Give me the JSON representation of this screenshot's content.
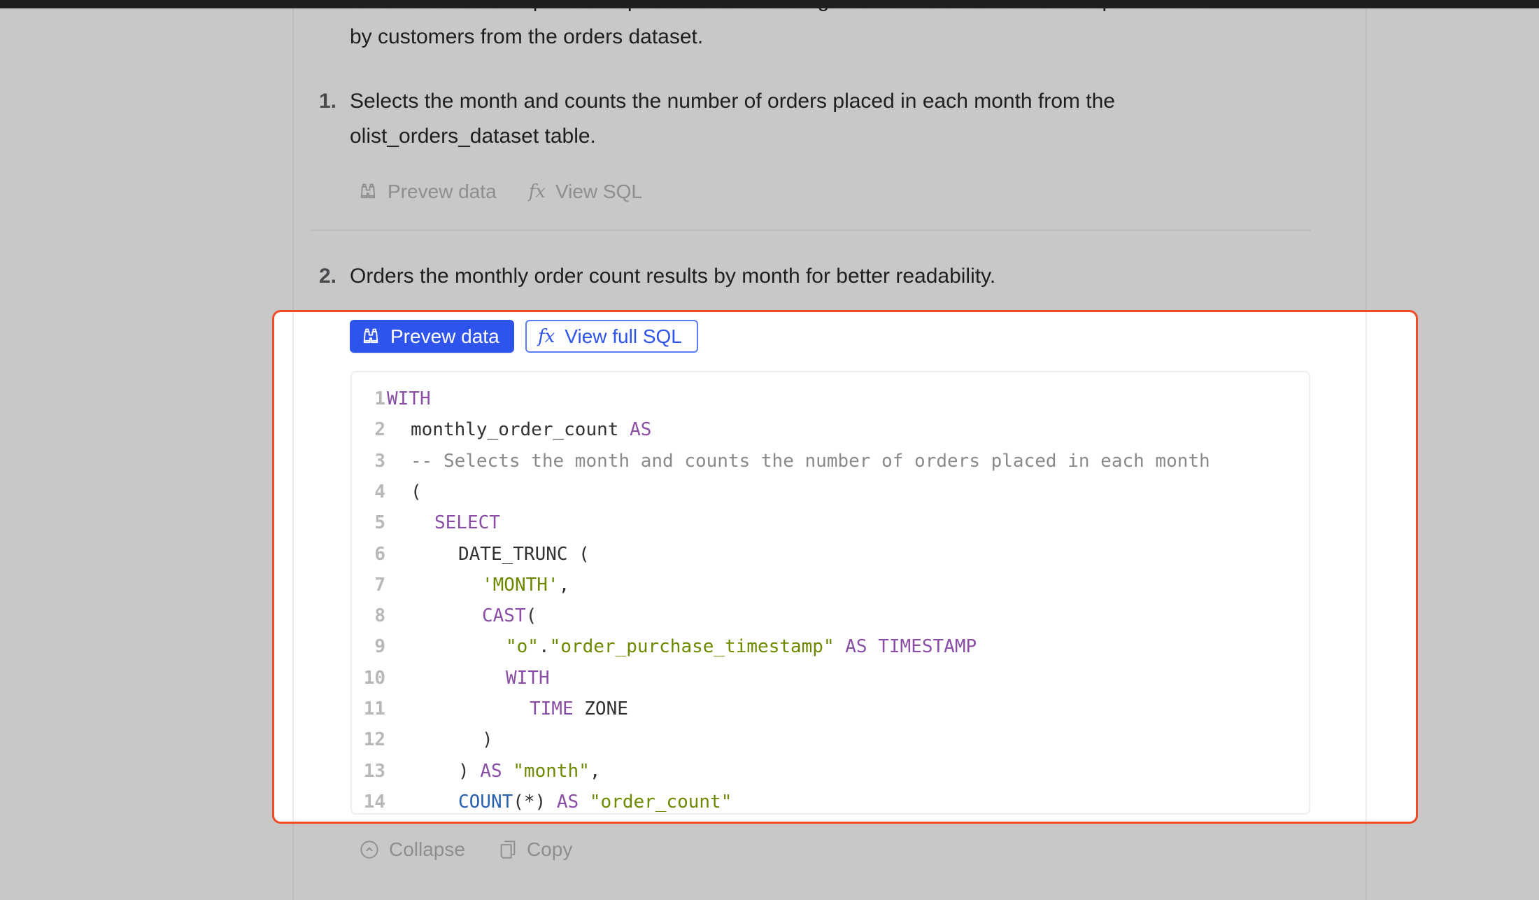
{
  "intro": {
    "line1_partial": "The breakdown simplifies the process of calculating the month-over-month order placements",
    "line2": "by customers from the orders dataset."
  },
  "steps": [
    {
      "number": "1.",
      "text": "Selects the month and counts the number of orders placed in each month from the olist_orders_dataset table.",
      "actions": {
        "preview_label": "Prevew data",
        "sql_label": "View SQL"
      }
    },
    {
      "number": "2.",
      "text": "Orders the monthly order count results by month for better readability.",
      "actions": {
        "preview_label": "Prevew data",
        "sql_label": "View full SQL"
      }
    }
  ],
  "icons": {
    "preview": "binoculars-icon",
    "sql": "fx-icon",
    "collapse": "chevron-up-circle-icon",
    "copy": "copy-icon"
  },
  "code": {
    "language": "sql",
    "lines": [
      {
        "n": "1",
        "indent": 0,
        "tokens": [
          {
            "t": "WITH",
            "c": "kw"
          }
        ]
      },
      {
        "n": "2",
        "indent": 1,
        "tokens": [
          {
            "t": "monthly_order_count ",
            "c": ""
          },
          {
            "t": "AS",
            "c": "kw"
          }
        ]
      },
      {
        "n": "3",
        "indent": 1,
        "tokens": [
          {
            "t": "-- Selects the month and counts the number of orders placed in each month",
            "c": "cm"
          }
        ]
      },
      {
        "n": "4",
        "indent": 1,
        "tokens": [
          {
            "t": "(",
            "c": ""
          }
        ]
      },
      {
        "n": "5",
        "indent": 2,
        "tokens": [
          {
            "t": "SELECT",
            "c": "kw"
          }
        ]
      },
      {
        "n": "6",
        "indent": 3,
        "tokens": [
          {
            "t": "DATE_TRUNC (",
            "c": ""
          }
        ]
      },
      {
        "n": "7",
        "indent": 4,
        "tokens": [
          {
            "t": "'MONTH'",
            "c": "str"
          },
          {
            "t": ",",
            "c": ""
          }
        ]
      },
      {
        "n": "8",
        "indent": 4,
        "tokens": [
          {
            "t": "CAST",
            "c": "kw"
          },
          {
            "t": "(",
            "c": ""
          }
        ]
      },
      {
        "n": "9",
        "indent": 5,
        "tokens": [
          {
            "t": "\"o\"",
            "c": "str"
          },
          {
            "t": ".",
            "c": ""
          },
          {
            "t": "\"order_purchase_timestamp\"",
            "c": "str"
          },
          {
            "t": " ",
            "c": ""
          },
          {
            "t": "AS TIMESTAMP",
            "c": "kw"
          }
        ]
      },
      {
        "n": "10",
        "indent": 5,
        "tokens": [
          {
            "t": "WITH",
            "c": "kw"
          }
        ]
      },
      {
        "n": "11",
        "indent": 6,
        "tokens": [
          {
            "t": "TIME",
            "c": "kw"
          },
          {
            "t": " ZONE",
            "c": ""
          }
        ]
      },
      {
        "n": "12",
        "indent": 4,
        "tokens": [
          {
            "t": ")",
            "c": ""
          }
        ]
      },
      {
        "n": "13",
        "indent": 3,
        "tokens": [
          {
            "t": ") ",
            "c": ""
          },
          {
            "t": "AS",
            "c": "kw"
          },
          {
            "t": " ",
            "c": ""
          },
          {
            "t": "\"month\"",
            "c": "str"
          },
          {
            "t": ",",
            "c": ""
          }
        ]
      },
      {
        "n": "14",
        "indent": 3,
        "tokens": [
          {
            "t": "COUNT",
            "c": "fn"
          },
          {
            "t": "(*) ",
            "c": ""
          },
          {
            "t": "AS",
            "c": "kw"
          },
          {
            "t": " ",
            "c": ""
          },
          {
            "t": "\"order_count\"",
            "c": "str"
          }
        ]
      }
    ]
  },
  "footer": {
    "collapse_label": "Collapse",
    "copy_label": "Copy"
  },
  "colors": {
    "primary": "#2f54eb",
    "highlight_outline": "#f24b26",
    "keyword": "#8a4ea6",
    "string": "#6b8a00",
    "comment": "#8a8a8a",
    "function": "#2a62b0"
  }
}
